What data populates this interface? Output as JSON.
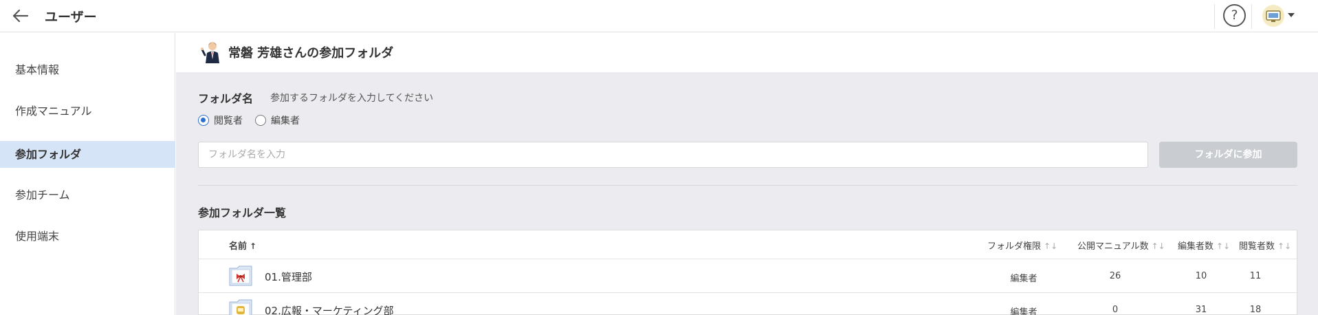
{
  "header": {
    "title": "ユーザー",
    "help_symbol": "?",
    "back_icon": "arrow-left-icon",
    "help_icon": "question-circle-icon",
    "account_icon": "account-avatar-icon"
  },
  "sidebar": {
    "items": [
      {
        "label": "基本情報",
        "active": false
      },
      {
        "label": "作成マニュアル",
        "active": false
      },
      {
        "label": "参加フォルダ",
        "active": true
      },
      {
        "label": "参加チーム",
        "active": false
      },
      {
        "label": "使用端末",
        "active": false
      }
    ]
  },
  "main": {
    "heading": "常磐 芳雄さんの参加フォルダ",
    "folder_label": "フォルダ名",
    "hint": "参加するフォルダを入力してください",
    "roles": [
      {
        "label": "閲覧者",
        "checked": true
      },
      {
        "label": "編集者",
        "checked": false
      }
    ],
    "input_placeholder": "フォルダ名を入力",
    "input_value": "",
    "join_button": "フォルダに参加",
    "list_heading": "参加フォルダ一覧"
  },
  "table": {
    "columns": {
      "name": "名前",
      "permission": "フォルダ権限",
      "published": "公開マニュアル数",
      "editors": "編集者数",
      "viewers": "閲覧者数"
    },
    "sort_up": "↑",
    "sort_both": "↑↓",
    "rows": [
      {
        "name": "01.管理部",
        "permission": "編集者",
        "published": "26",
        "editors": "10",
        "viewers": "11",
        "icon": "folder-ribbon-icon"
      },
      {
        "name": "02.広報・マーケティング部",
        "permission": "編集者",
        "published": "0",
        "editors": "31",
        "viewers": "18",
        "icon": "folder-badge-icon"
      }
    ]
  },
  "colors": {
    "accent": "#2d6fd0",
    "sidebar_active": "#d6e4f7",
    "main_bg": "#ececf0",
    "disabled_button": "#c9ccd1"
  }
}
